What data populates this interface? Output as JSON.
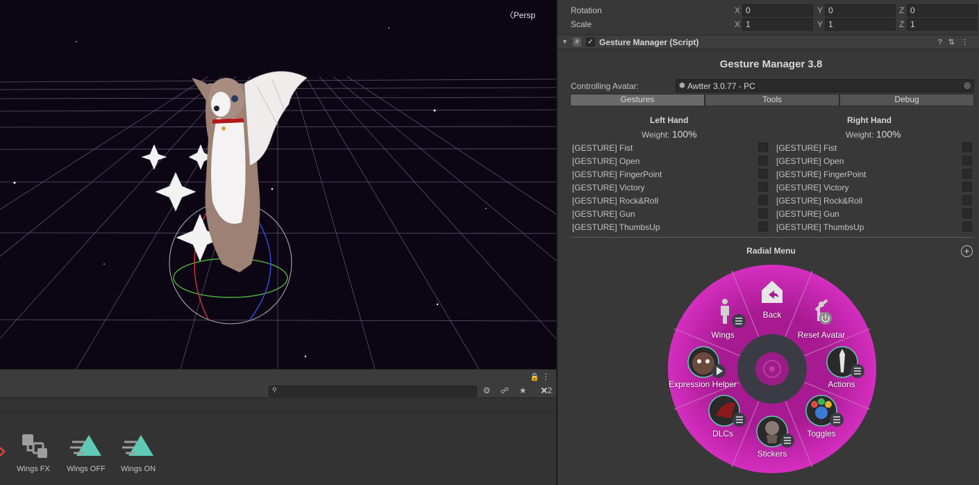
{
  "scene": {
    "view_mode": "Persp"
  },
  "project": {
    "search_placeholder": "",
    "hidden_count": "2",
    "assets": [
      {
        "label": "Wings FX",
        "icon": "animator-controller-icon"
      },
      {
        "label": "Wings OFF",
        "icon": "animation-clip-icon"
      },
      {
        "label": "Wings ON",
        "icon": "animation-clip-icon"
      }
    ]
  },
  "transform": {
    "rotation": {
      "label": "Rotation",
      "x": "0",
      "y": "0",
      "z": "0"
    },
    "scale": {
      "label": "Scale",
      "x": "1",
      "y": "1",
      "z": "1"
    }
  },
  "component": {
    "title": "Gesture Manager (Script)",
    "enabled": true
  },
  "gesture_manager": {
    "title": "Gesture Manager 3.8",
    "controlling_label": "Controlling Avatar:",
    "avatar": "Awtter 3.0.77 - PC",
    "tabs": [
      "Gestures",
      "Tools",
      "Debug"
    ],
    "active_tab": "Gestures",
    "weight_label": "Weight:",
    "left": {
      "title": "Left Hand",
      "weight": "100%"
    },
    "right": {
      "title": "Right Hand",
      "weight": "100%"
    },
    "gestures": [
      "[GESTURE] Fist",
      "[GESTURE] Open",
      "[GESTURE] FingerPoint",
      "[GESTURE] Victory",
      "[GESTURE] Rock&Roll",
      "[GESTURE] Gun",
      "[GESTURE] ThumbsUp"
    ],
    "radial_title": "Radial Menu",
    "radial_items": [
      "Back",
      "Reset Avatar",
      "Actions",
      "Toggles",
      "Stickers",
      "DLCs",
      "Expression Helper",
      "Wings"
    ]
  },
  "colors": {
    "radial_outer": "#c21ea8",
    "radial_inner": "#3b3b45",
    "accent": "#5fc9b6"
  }
}
